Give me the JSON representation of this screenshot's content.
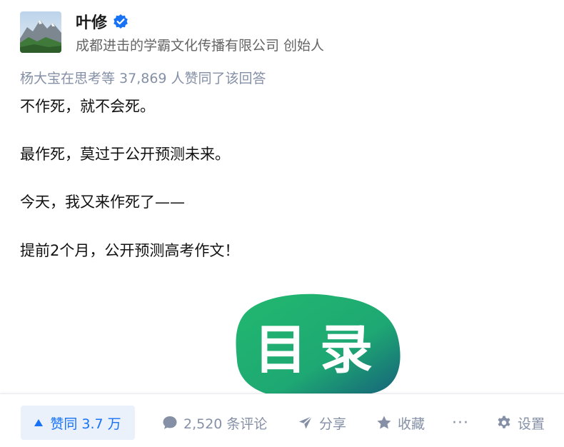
{
  "author": {
    "name": "叶修",
    "headline": "成都进击的学霸文化传播有限公司 创始人"
  },
  "voters_line": "杨大宝在思考等 37,869 人赞同了该回答",
  "content": {
    "paragraphs": [
      "不作死，就不会死。",
      "最作死，莫过于公开预测未来。",
      "今天，我又来作死了——",
      "提前2个月，公开预测高考作文！"
    ],
    "image_text": "目录"
  },
  "actions": {
    "vote": "赞同 3.7 万",
    "comment": "2,520 条评论",
    "share": "分享",
    "collect": "收藏",
    "more": "···",
    "settings": "设置"
  },
  "colors": {
    "accent": "#1772f6",
    "vote_bg": "#eaf1fb",
    "muted": "#8590a6",
    "image_green": "#1fae6d"
  }
}
